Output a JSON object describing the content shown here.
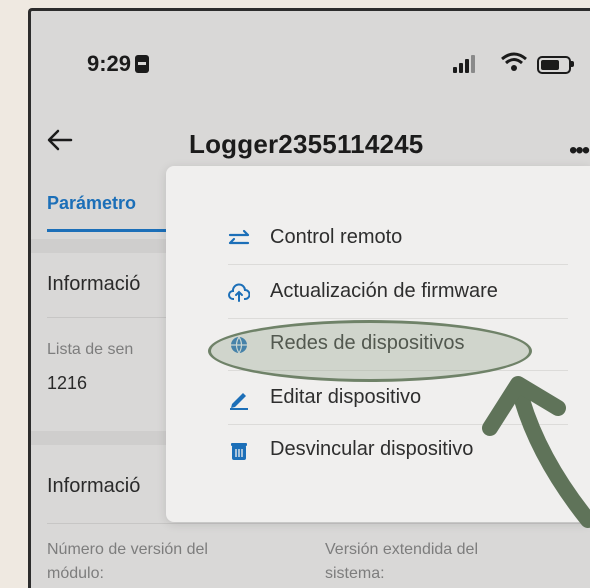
{
  "status_bar": {
    "time": "9:29"
  },
  "app_bar": {
    "title": "Logger2355114245"
  },
  "tabs": [
    {
      "label": "Parámetro"
    }
  ],
  "sections": {
    "info1_title": "Informació",
    "sensor_label": "Lista de sen",
    "sensor_value": "1216",
    "info2_title": "Informació",
    "module_version_label_l1": "Número de versión del",
    "module_version_label_l2": "módulo:",
    "system_ext_label_l1": "Versión extendida del",
    "system_ext_label_l2": "sistema:"
  },
  "menu": {
    "items": [
      {
        "label": "Control remoto",
        "icon": "remote-control-icon"
      },
      {
        "label": "Actualización de firmware",
        "icon": "cloud-upload-icon"
      },
      {
        "label": "Redes de dispositivos",
        "icon": "globe-icon"
      },
      {
        "label": "Editar dispositivo",
        "icon": "pencil-icon"
      },
      {
        "label": "Desvincular dispositivo",
        "icon": "trash-icon"
      }
    ],
    "highlighted_index": 2
  },
  "colors": {
    "accent": "#1c6fb8",
    "annotation": "#6f8268"
  }
}
